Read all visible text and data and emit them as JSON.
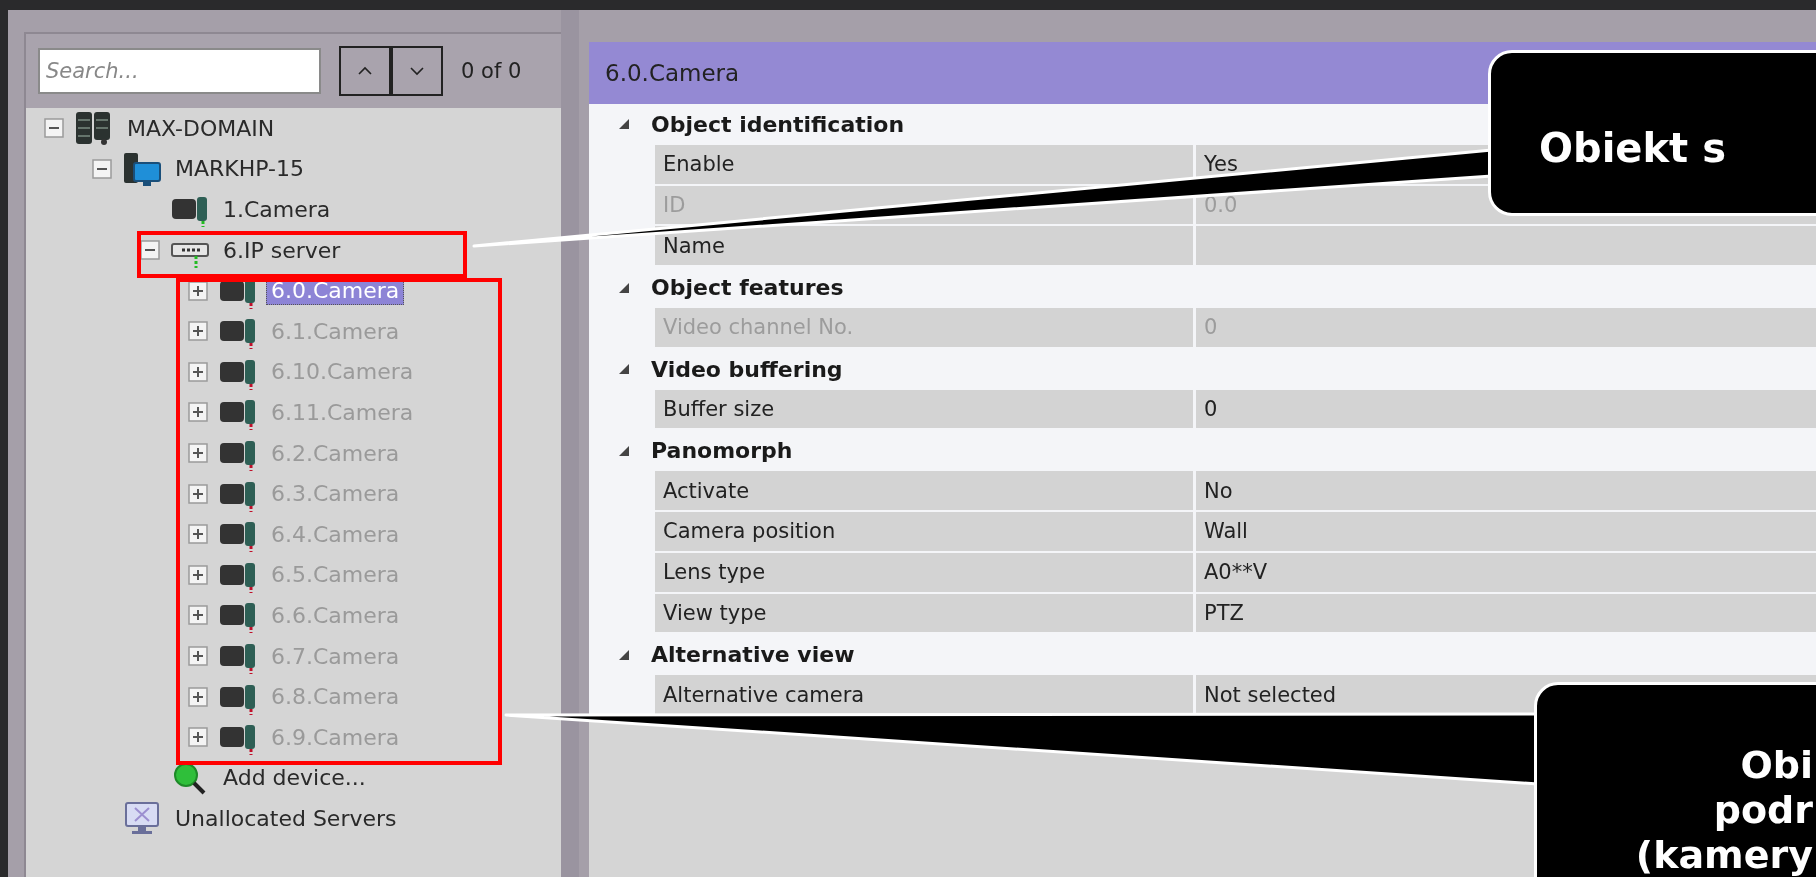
{
  "search": {
    "placeholder": "Search...",
    "match_count": "0 of 0"
  },
  "tree": [
    {
      "label": "MAX-DOMAIN",
      "kind": "domain",
      "expanded": true,
      "selected": false,
      "disabled": false,
      "children": [
        {
          "label": "MARKHP-15",
          "kind": "computer",
          "expanded": true,
          "selected": false,
          "disabled": false,
          "children": [
            {
              "label": "1.Camera",
              "kind": "camera",
              "selected": false,
              "disabled": false
            },
            {
              "label": "6.IP server",
              "kind": "ip-server",
              "expanded": true,
              "selected": false,
              "disabled": false,
              "children": [
                {
                  "label": "6.0.Camera",
                  "kind": "camera",
                  "expanded": false,
                  "selected": true,
                  "disabled": true
                },
                {
                  "label": "6.1.Camera",
                  "kind": "camera",
                  "expanded": false,
                  "selected": false,
                  "disabled": true
                },
                {
                  "label": "6.10.Camera",
                  "kind": "camera",
                  "expanded": false,
                  "selected": false,
                  "disabled": true
                },
                {
                  "label": "6.11.Camera",
                  "kind": "camera",
                  "expanded": false,
                  "selected": false,
                  "disabled": true
                },
                {
                  "label": "6.2.Camera",
                  "kind": "camera",
                  "expanded": false,
                  "selected": false,
                  "disabled": true
                },
                {
                  "label": "6.3.Camera",
                  "kind": "camera",
                  "expanded": false,
                  "selected": false,
                  "disabled": true
                },
                {
                  "label": "6.4.Camera",
                  "kind": "camera",
                  "expanded": false,
                  "selected": false,
                  "disabled": true
                },
                {
                  "label": "6.5.Camera",
                  "kind": "camera",
                  "expanded": false,
                  "selected": false,
                  "disabled": true
                },
                {
                  "label": "6.6.Camera",
                  "kind": "camera",
                  "expanded": false,
                  "selected": false,
                  "disabled": true
                },
                {
                  "label": "6.7.Camera",
                  "kind": "camera",
                  "expanded": false,
                  "selected": false,
                  "disabled": true
                },
                {
                  "label": "6.8.Camera",
                  "kind": "camera",
                  "expanded": false,
                  "selected": false,
                  "disabled": true
                },
                {
                  "label": "6.9.Camera",
                  "kind": "camera",
                  "expanded": false,
                  "selected": false,
                  "disabled": true
                }
              ]
            },
            {
              "label": "Add device...",
              "kind": "add",
              "selected": false,
              "disabled": false
            }
          ]
        },
        {
          "label": "Unallocated Servers",
          "kind": "unallocated",
          "selected": false,
          "disabled": false
        }
      ]
    }
  ],
  "properties": {
    "title": "6.0.Camera",
    "groups": [
      {
        "title": "Object identification",
        "expanded": true,
        "rows": [
          {
            "label": "Enable",
            "value": "Yes",
            "disabled": false
          },
          {
            "label": "ID",
            "value": "0.0",
            "disabled": true
          },
          {
            "label": "Name",
            "disabled": false
          }
        ]
      },
      {
        "title": "Object features",
        "expanded": true,
        "rows": [
          {
            "label": "Video channel No.",
            "value": "0",
            "disabled": true
          }
        ]
      },
      {
        "title": "Video buffering",
        "expanded": true,
        "rows": [
          {
            "label": "Buffer size",
            "value": "0",
            "disabled": false
          }
        ]
      },
      {
        "title": "Panomorph",
        "expanded": true,
        "rows": [
          {
            "label": "Activate",
            "value": "No",
            "disabled": false
          },
          {
            "label": "Camera position",
            "value": "Wall",
            "disabled": false
          },
          {
            "label": "Lens type",
            "value": "A0**V",
            "disabled": false
          },
          {
            "label": "View type",
            "value": "PTZ",
            "disabled": false
          }
        ]
      },
      {
        "title": "Alternative view",
        "expanded": true,
        "rows": [
          {
            "label": "Alternative camera",
            "value": "Not selected",
            "disabled": false
          }
        ]
      }
    ]
  },
  "callouts": [
    {
      "lines": [
        "Obiekt s"
      ]
    },
    {
      "lines": [
        "Obi",
        "podr",
        "(kamery"
      ]
    }
  ]
}
